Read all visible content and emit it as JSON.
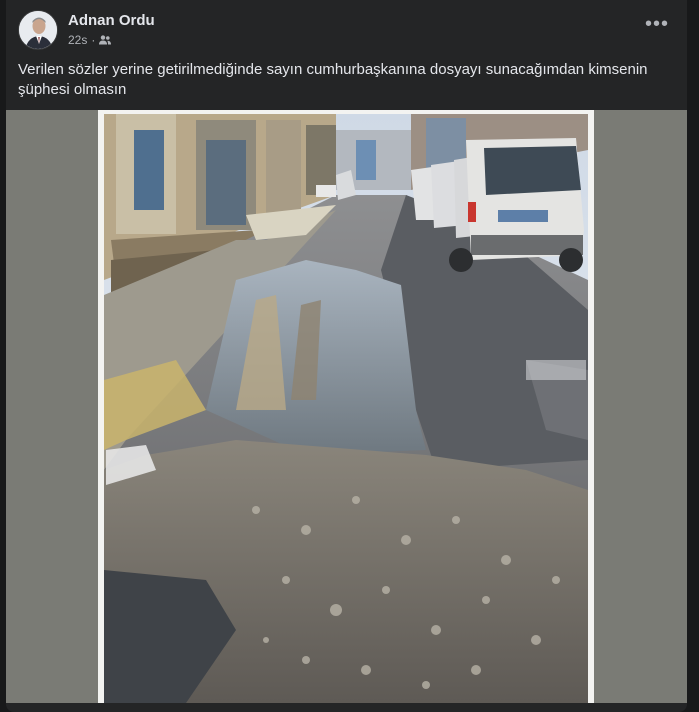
{
  "post": {
    "author": "Adnan Ordu",
    "time": "22s",
    "separator": "·",
    "audience_icon": "friends-icon",
    "menu_label": "•••",
    "text": "Verilen sözler yerine getirilmediğinde sayın cumhurbaşkanına dosyayı sunacağımdan kimsenin şüphesi olmasın"
  },
  "colors": {
    "background": "#18191a",
    "card": "#242526",
    "text_primary": "#e4e6eb",
    "text_secondary": "#b0b3b8"
  }
}
